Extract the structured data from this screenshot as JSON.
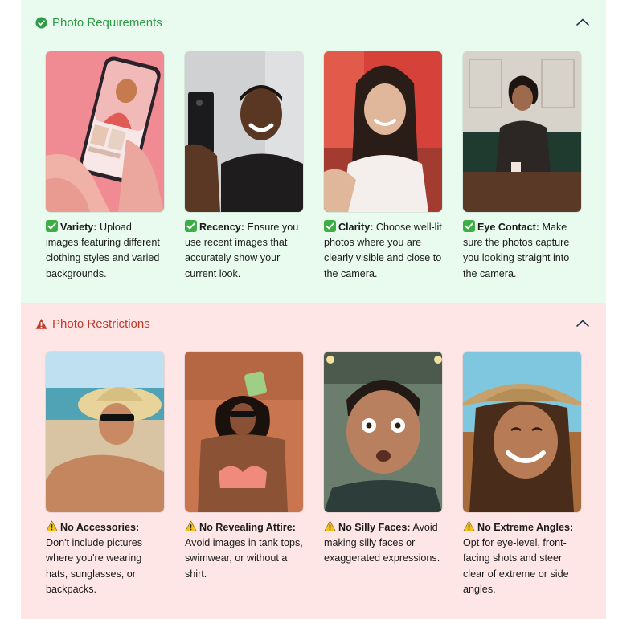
{
  "requirements": {
    "title": "Photo Requirements",
    "icon": "check-circle-icon",
    "accent": "#2f9a47",
    "background": "#e9fbef",
    "toggle_icon": "chevron-up-icon",
    "items": [
      {
        "lead": "Variety:",
        "text": "Upload images featuring different clothing styles and varied backgrounds.",
        "badge": "green-check-icon",
        "photo": "phone-selfie-photo"
      },
      {
        "lead": "Recency:",
        "text": "Ensure you use recent images that accurately show your current look.",
        "badge": "green-check-icon",
        "photo": "smiling-man-selfie-photo"
      },
      {
        "lead": "Clarity:",
        "text": "Choose well-lit photos where you are clearly visible and close to the camera.",
        "badge": "green-check-icon",
        "photo": "smiling-woman-selfie-photo"
      },
      {
        "lead": "Eye Contact:",
        "text": "Make sure the photos capture you looking straight into the camera.",
        "badge": "green-check-icon",
        "photo": "woman-at-table-photo"
      }
    ]
  },
  "restrictions": {
    "title": "Photo Restrictions",
    "icon": "warning-icon",
    "accent": "#c0392b",
    "background": "#fde6e5",
    "toggle_icon": "chevron-up-icon",
    "items": [
      {
        "lead": "No Accessories:",
        "text": "Don't include pictures where you're wearing hats, sunglasses, or backpacks.",
        "badge": "warning-icon",
        "photo": "man-hat-sunglasses-photo"
      },
      {
        "lead": "No Revealing Attire:",
        "text": "Avoid images in tank tops, swimwear, or without a shirt.",
        "badge": "warning-icon",
        "photo": "woman-swimwear-photo"
      },
      {
        "lead": "No Silly Faces:",
        "text": "Avoid making silly faces or exaggerated expressions.",
        "badge": "warning-icon",
        "photo": "surprised-man-photo"
      },
      {
        "lead": "No Extreme Angles:",
        "text": "Opt for eye-level, front-facing shots and steer clear of extreme or side angles.",
        "badge": "warning-icon",
        "photo": "low-angle-woman-photo"
      }
    ]
  }
}
